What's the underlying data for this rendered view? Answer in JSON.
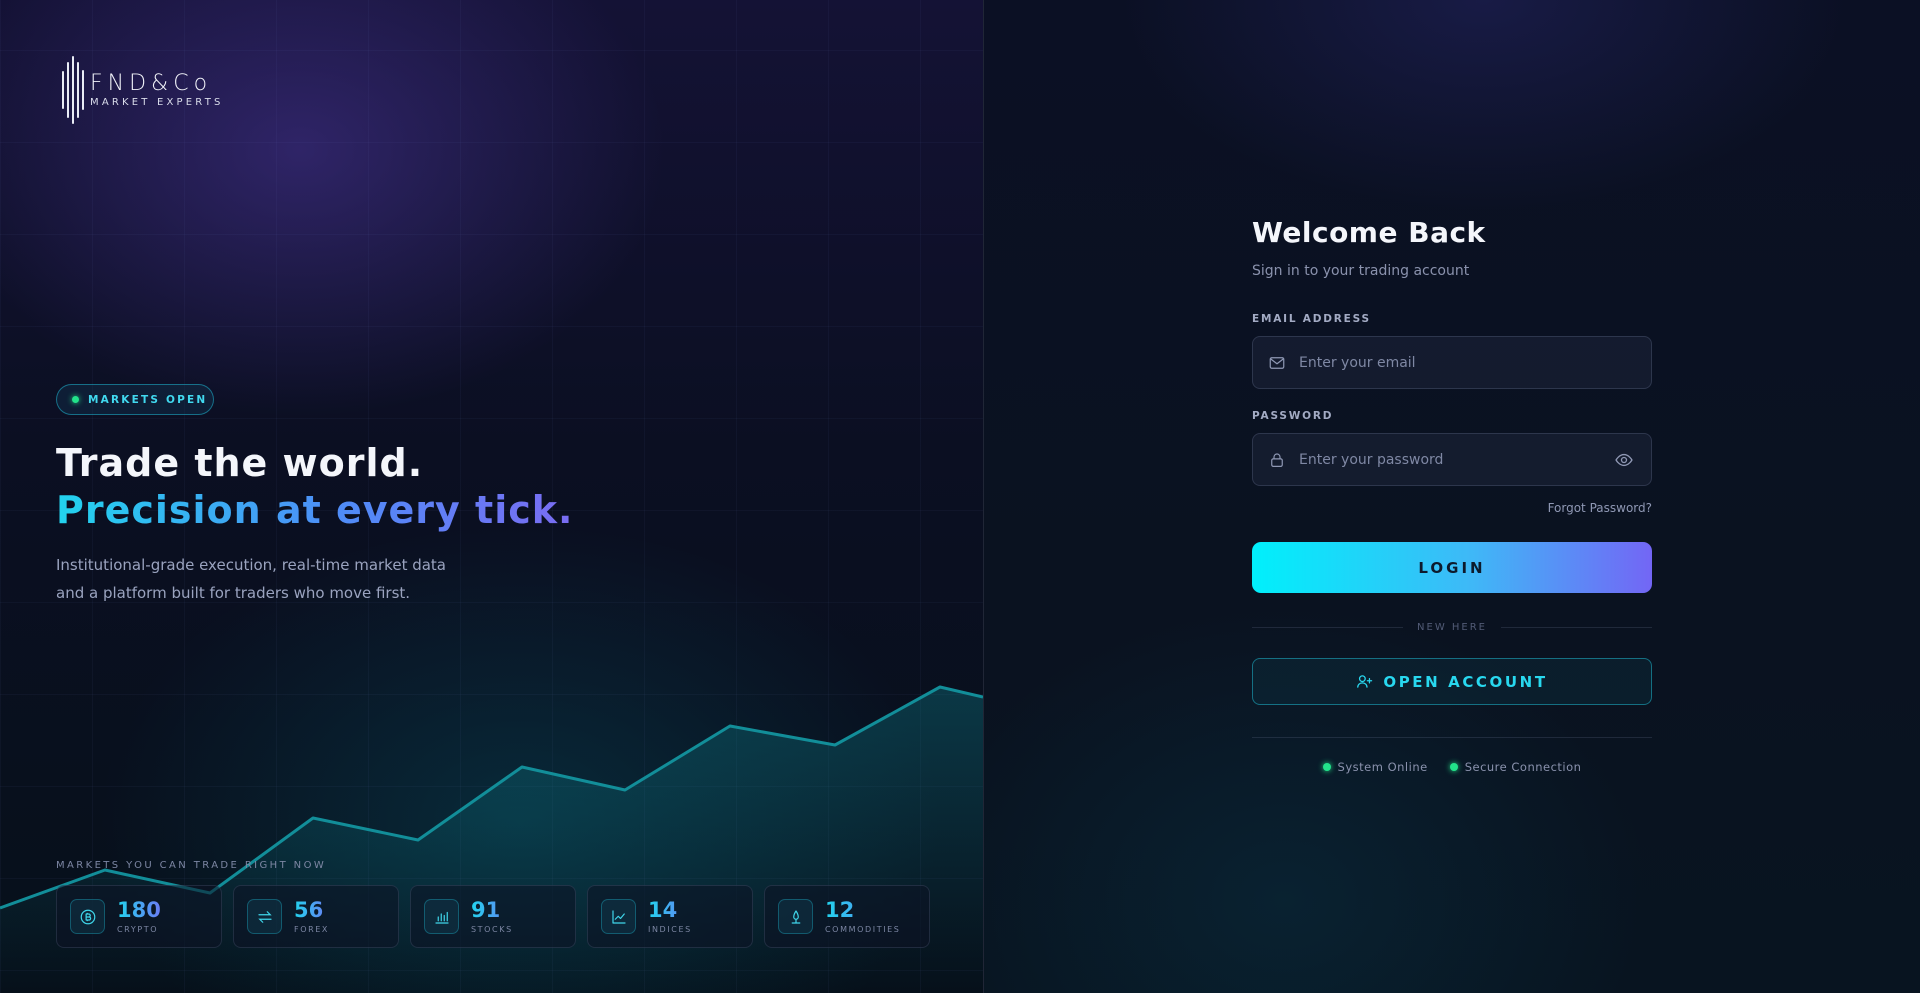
{
  "brand": {
    "name": "FND&Co",
    "tagline": "MARKET EXPERTS"
  },
  "hero": {
    "badge": "MARKETS OPEN",
    "title_line1": "Trade the world.",
    "title_line2": "Precision at every tick.",
    "description": "Institutional-grade execution, real-time market data and a platform built for traders who move first."
  },
  "markets": {
    "label": "MARKETS YOU CAN TRADE RIGHT NOW",
    "items": [
      {
        "count": "180",
        "name": "CRYPTO",
        "icon": "bitcoin-icon"
      },
      {
        "count": "56",
        "name": "FOREX",
        "icon": "exchange-arrows-icon"
      },
      {
        "count": "91",
        "name": "STOCKS",
        "icon": "bar-chart-icon"
      },
      {
        "count": "14",
        "name": "INDICES",
        "icon": "line-chart-icon"
      },
      {
        "count": "12",
        "name": "COMMODITIES",
        "icon": "commodity-icon"
      }
    ]
  },
  "login": {
    "title": "Welcome Back",
    "subtitle": "Sign in to your trading account",
    "email_label": "EMAIL ADDRESS",
    "email_placeholder": "Enter your email",
    "password_label": "PASSWORD",
    "password_placeholder": "Enter your password",
    "forgot": "Forgot Password?",
    "login_button": "LOGIN",
    "divider": "NEW HERE",
    "open_account": "OPEN ACCOUNT",
    "status": [
      "System Online",
      "Secure Connection"
    ]
  },
  "colors": {
    "accent_cyan": "#22d3ee",
    "accent_violet": "#7366f5",
    "status_green": "#22e38a"
  }
}
